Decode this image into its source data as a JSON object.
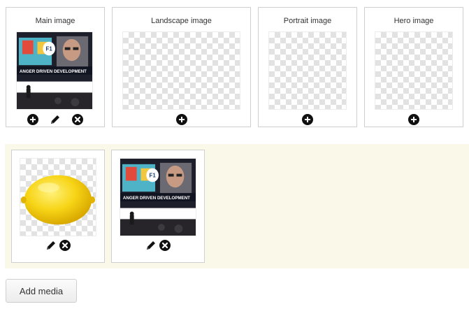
{
  "slots": [
    {
      "title": "Main image"
    },
    {
      "title": "Landscape image"
    },
    {
      "title": "Portrait image"
    },
    {
      "title": "Hero image"
    }
  ],
  "photo": {
    "banner_text": "ANGER DRIVEN DEVELOPMENT",
    "badge_text": "F1"
  },
  "add_media_label": "Add media",
  "icons": {
    "add": "plus-circle-icon",
    "edit": "pencil-icon",
    "remove": "x-circle-icon"
  }
}
